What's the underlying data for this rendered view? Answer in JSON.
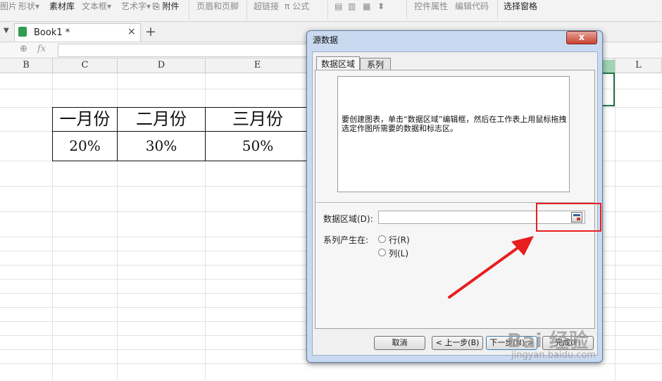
{
  "ribbon": {
    "items": [
      "图片",
      "形状",
      "素材库",
      "文本框",
      "艺术字",
      "附件",
      "页眉和页脚",
      "超链接",
      "公式",
      "控件属性",
      "编辑代码",
      "选择窗格"
    ],
    "dropdown_glyph": "▾"
  },
  "tabs": {
    "book_label": "Book1 *",
    "close": "×",
    "new_tab": "+"
  },
  "formula_bar": {
    "zoom_icon": "⊕",
    "fx": "fx",
    "value": ""
  },
  "columns": [
    "B",
    "C",
    "D",
    "E",
    "L"
  ],
  "table": {
    "headers": [
      "一月份",
      "二月份",
      "三月份"
    ],
    "values": [
      "20%",
      "30%",
      "50%"
    ]
  },
  "dialog": {
    "title": "源数据",
    "close_label": "x",
    "tabs": [
      "数据区域",
      "系列"
    ],
    "hint": "要创建图表，单击“数据区域”编辑框，然后在工作表上用鼠标拖拽选定作图所需要的数据和标志区。",
    "range_label": "数据区域(D):",
    "range_value": "",
    "series_label": "系列产生在:",
    "series_options": [
      "行(R)",
      "列(L)"
    ],
    "buttons": {
      "cancel": "取消",
      "back": "< 上一步(B)",
      "next": "下一步(N) >",
      "finish": "完成(F)"
    }
  },
  "watermark": {
    "brand": "Bai 经验",
    "url": "jingyan.baidu.com"
  },
  "colors": {
    "annotation_red": "#e81e1e",
    "selection_green": "#217346",
    "dialog_frame": "#c9daf0"
  }
}
